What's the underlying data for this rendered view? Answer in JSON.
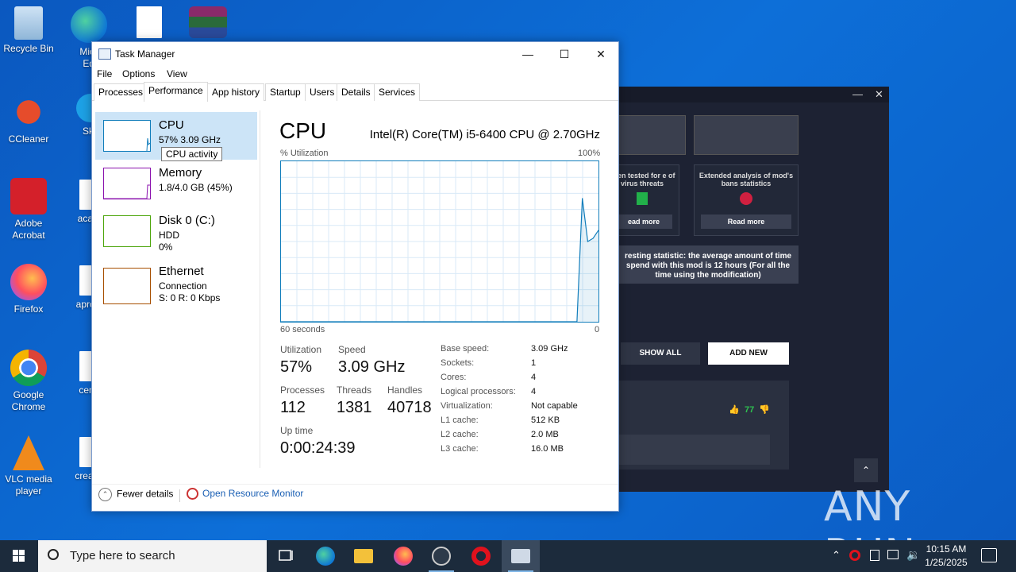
{
  "desktop": {
    "icons": [
      {
        "label": "Recycle Bin"
      },
      {
        "label": "Micro Edg"
      },
      {
        "label": "CCleaner"
      },
      {
        "label": "Sky"
      },
      {
        "label": "Adobe Acrobat"
      },
      {
        "label": "acade"
      },
      {
        "label": "Firefox"
      },
      {
        "label": "aprcon"
      },
      {
        "label": "Google Chrome"
      },
      {
        "label": "centu"
      },
      {
        "label": "VLC media player"
      },
      {
        "label": "createc"
      }
    ]
  },
  "bg_app": {
    "card1_text": "been tested for e of virus threats",
    "card1_button": "ead more",
    "card2_text": "Extended analysis of mod's bans statistics",
    "card2_button": "Read more",
    "stat_text": "resting statistic: the average amount of time spend with this mod is 12 hours (For all the time using the modification)",
    "show_all": "SHOW ALL",
    "add_new": "ADD NEW",
    "likes": "77"
  },
  "taskmgr": {
    "title": "Task Manager",
    "menu": [
      "File",
      "Options",
      "View"
    ],
    "tabs": [
      "Processes",
      "Performance",
      "App history",
      "Startup",
      "Users",
      "Details",
      "Services"
    ],
    "active_tab": "Performance",
    "sidebar": {
      "cpu": {
        "name": "CPU",
        "line1": "57%  3.09 GHz"
      },
      "memory": {
        "name": "Memory",
        "line1": "1.8/4.0 GB (45%)"
      },
      "disk": {
        "name": "Disk 0 (C:)",
        "line1": "HDD",
        "line2": "0%"
      },
      "ethernet": {
        "name": "Ethernet",
        "line1": "Connection",
        "line2": "S: 0 R: 0 Kbps"
      },
      "tooltip": "CPU activity"
    },
    "main": {
      "heading": "CPU",
      "model": "Intel(R) Core(TM) i5-6400 CPU @ 2.70GHz",
      "util_label": "% Utilization",
      "max_label": "100%",
      "time_label": "60 seconds",
      "zero_label": "0",
      "stats": {
        "utilization_label": "Utilization",
        "utilization": "57%",
        "speed_label": "Speed",
        "speed": "3.09 GHz",
        "processes_label": "Processes",
        "processes": "112",
        "threads_label": "Threads",
        "threads": "1381",
        "handles_label": "Handles",
        "handles": "40718",
        "uptime_label": "Up time",
        "uptime": "0:00:24:39"
      },
      "details": [
        {
          "k": "Base speed:",
          "v": "3.09 GHz"
        },
        {
          "k": "Sockets:",
          "v": "1"
        },
        {
          "k": "Cores:",
          "v": "4"
        },
        {
          "k": "Logical processors:",
          "v": "4"
        },
        {
          "k": "Virtualization:",
          "v": "Not capable"
        },
        {
          "k": "L1 cache:",
          "v": "512 KB"
        },
        {
          "k": "L2 cache:",
          "v": "2.0 MB"
        },
        {
          "k": "L3 cache:",
          "v": "16.0 MB"
        }
      ],
      "cpu_history_percent": [
        0,
        0,
        0,
        0,
        0,
        0,
        0,
        0,
        0,
        0,
        0,
        0,
        0,
        0,
        0,
        0,
        0,
        0,
        0,
        0,
        0,
        0,
        0,
        0,
        0,
        0,
        0,
        0,
        0,
        0,
        0,
        0,
        0,
        0,
        0,
        0,
        0,
        0,
        0,
        0,
        0,
        0,
        0,
        0,
        0,
        0,
        0,
        0,
        0,
        0,
        0,
        0,
        0,
        0,
        0,
        0,
        77,
        50,
        52,
        57
      ]
    },
    "footer": {
      "fewer": "Fewer details",
      "open_rm": "Open Resource Monitor"
    }
  },
  "taskbar": {
    "search_placeholder": "Type here to search",
    "time": "10:15 AM",
    "date": "1/25/2025"
  },
  "watermark": "ANY RUN",
  "colors": {
    "accent": "#117dbb",
    "desktop": "#0b63cf",
    "taskbar": "#1c2b3c"
  }
}
